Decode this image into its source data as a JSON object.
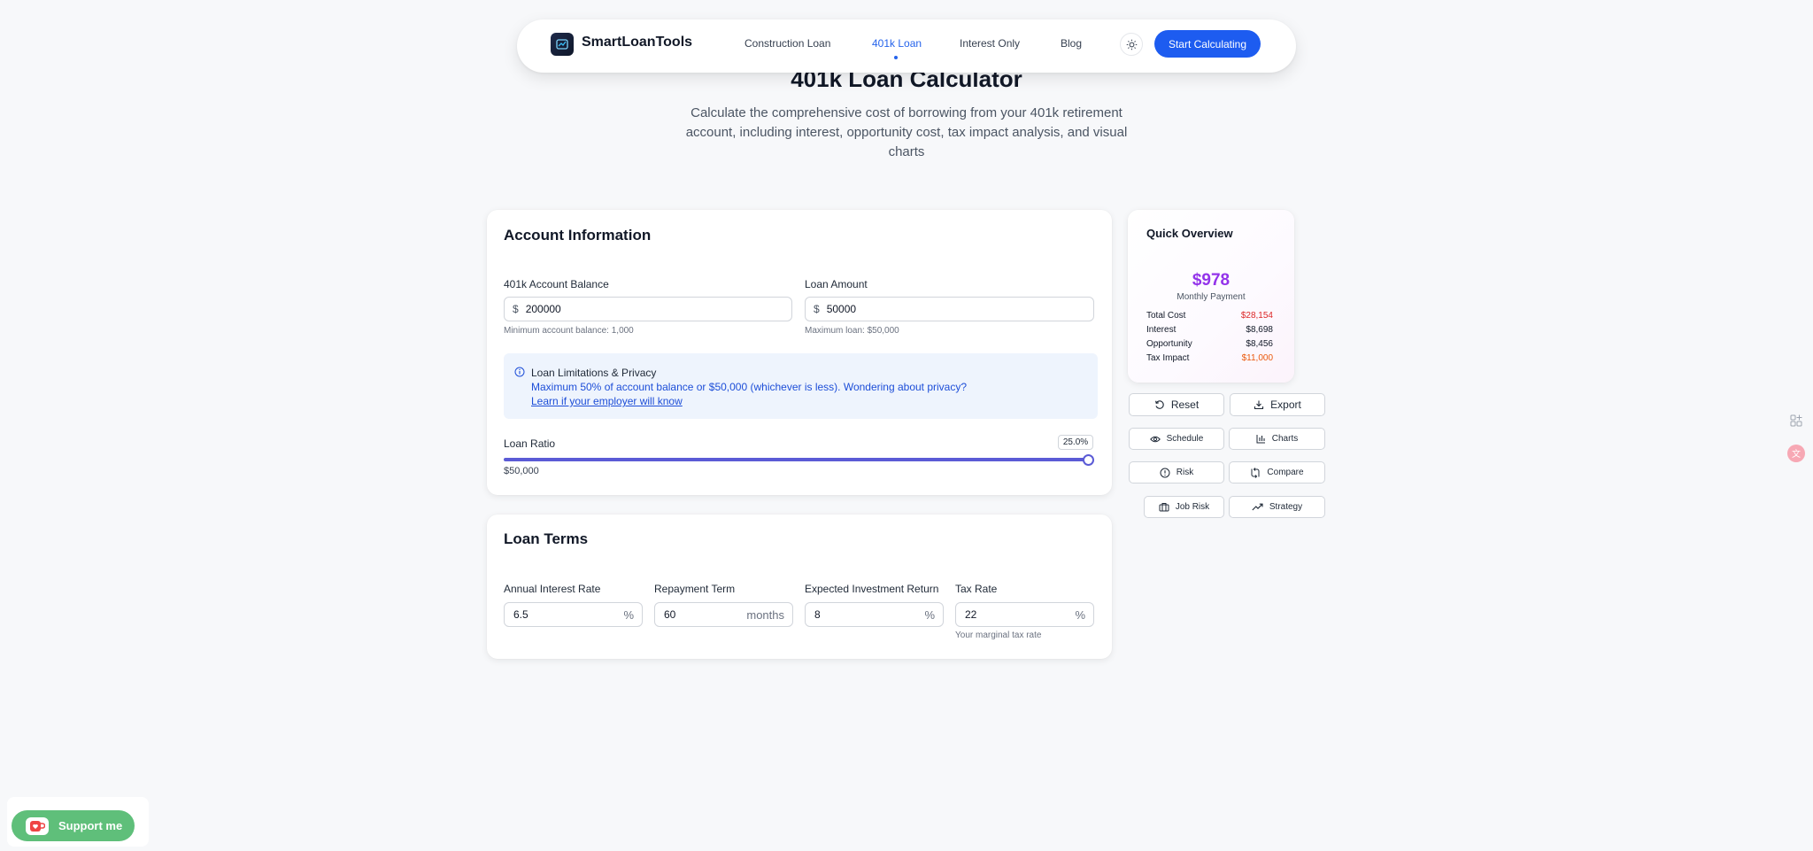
{
  "nav": {
    "brand": "SmartLoanTools",
    "links": [
      "Construction Loan",
      "401k Loan",
      "Interest Only",
      "Blog"
    ],
    "active_link": "401k Loan",
    "cta": "Start Calculating"
  },
  "hero": {
    "title": "401k Loan Calculator",
    "subtitle": "Calculate the comprehensive cost of borrowing from your 401k retirement account, including interest, opportunity cost, tax impact analysis, and visual charts"
  },
  "account": {
    "title": "Account Information",
    "balance_label": "401k Account Balance",
    "balance_prefix": "$",
    "balance_value": "200000",
    "balance_hint": "Minimum account balance: 1,000",
    "loan_label": "Loan Amount",
    "loan_prefix": "$",
    "loan_value": "50000",
    "loan_hint": "Maximum loan: $50,000",
    "info_title": "Loan Limitations & Privacy",
    "info_text": "Maximum 50% of account balance or $50,000 (whichever is less). Wondering about privacy?",
    "info_link": "Learn if your employer will know",
    "ratio_label": "Loan Ratio",
    "ratio_badge": "25.0%",
    "ratio_fraction": 1.0,
    "ratio_amount": "$50,000"
  },
  "terms": {
    "title": "Loan Terms",
    "fields": [
      {
        "label": "Annual Interest Rate",
        "value": "6.5",
        "suffix": "%"
      },
      {
        "label": "Repayment Term",
        "value": "60",
        "suffix": "months"
      },
      {
        "label": "Expected Investment Return",
        "value": "8",
        "suffix": "%"
      },
      {
        "label": "Tax Rate",
        "value": "22",
        "suffix": "%"
      }
    ],
    "tax_hint": "Your marginal tax rate"
  },
  "overview": {
    "title": "Quick Overview",
    "amount": "$978",
    "amount_label": "Monthly Payment",
    "rows": [
      {
        "label": "Total Cost",
        "value": "$28,154",
        "color": "#dc2626"
      },
      {
        "label": "Interest",
        "value": "$8,698",
        "color": "#111827"
      },
      {
        "label": "Opportunity",
        "value": "$8,456",
        "color": "#111827"
      },
      {
        "label": "Tax Impact",
        "value": "$11,000",
        "color": "#ea580c"
      }
    ]
  },
  "actions": {
    "reset": "Reset",
    "export": "Export",
    "schedule": "Schedule",
    "charts": "Charts",
    "risk": "Risk",
    "compare": "Compare",
    "job_risk": "Job Risk",
    "strategy": "Strategy"
  },
  "support": {
    "label": "Support me"
  },
  "colors": {
    "accent": "#1d5cf0",
    "slider": "#5b5bd6",
    "overview_amount": "#9333ea"
  }
}
